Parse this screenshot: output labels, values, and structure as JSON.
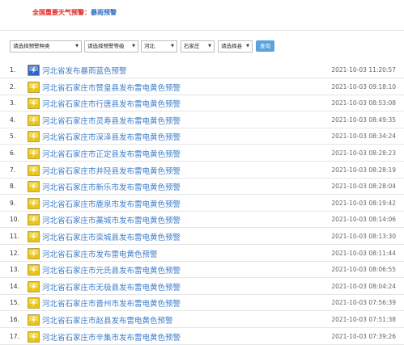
{
  "banner": {
    "prefix": "全国重要天气预警：",
    "active": "暴雨预警"
  },
  "filters": {
    "type": "请选择预警种类",
    "level": "请选择预警等级",
    "province": "河北",
    "city": "石家庄",
    "county": "请选择县",
    "query_label": "查询"
  },
  "list": [
    {
      "num": "1.",
      "title": "河北省发布暴雨蓝色预警",
      "time": "2021-10-03 11:20:57",
      "icon": "rainstorm-blue-warning-icon",
      "color": "#2f63c4"
    },
    {
      "num": "2.",
      "title": "河北省石家庄市赞皇县发布雷电黄色预警",
      "time": "2021-10-03 09:18:10",
      "icon": "lightning-yellow-warning-icon",
      "color": "#e8c516"
    },
    {
      "num": "3.",
      "title": "河北省石家庄市行唐县发布雷电黄色预警",
      "time": "2021-10-03 08:53:08",
      "icon": "lightning-yellow-warning-icon",
      "color": "#e8c516"
    },
    {
      "num": "4.",
      "title": "河北省石家庄市灵寿县发布雷电黄色预警",
      "time": "2021-10-03 08:49:35",
      "icon": "lightning-yellow-warning-icon",
      "color": "#e8c516"
    },
    {
      "num": "5.",
      "title": "河北省石家庄市深泽县发布雷电黄色预警",
      "time": "2021-10-03 08:34:24",
      "icon": "lightning-yellow-warning-icon",
      "color": "#e8c516"
    },
    {
      "num": "6.",
      "title": "河北省石家庄市正定县发布雷电黄色预警",
      "time": "2021-10-03 08:28:23",
      "icon": "lightning-yellow-warning-icon",
      "color": "#e8c516"
    },
    {
      "num": "7.",
      "title": "河北省石家庄市井陉县发布雷电黄色预警",
      "time": "2021-10-03 08:28:19",
      "icon": "lightning-yellow-warning-icon",
      "color": "#e8c516"
    },
    {
      "num": "8.",
      "title": "河北省石家庄市新乐市发布雷电黄色预警",
      "time": "2021-10-03 08:28:04",
      "icon": "lightning-yellow-warning-icon",
      "color": "#e8c516"
    },
    {
      "num": "9.",
      "title": "河北省石家庄市鹿泉市发布雷电黄色预警",
      "time": "2021-10-03 08:19:42",
      "icon": "lightning-yellow-warning-icon",
      "color": "#e8c516"
    },
    {
      "num": "10.",
      "title": "河北省石家庄市藁城市发布雷电黄色预警",
      "time": "2021-10-03 08:14:06",
      "icon": "lightning-yellow-warning-icon",
      "color": "#e8c516"
    },
    {
      "num": "11.",
      "title": "河北省石家庄市栾城县发布雷电黄色预警",
      "time": "2021-10-03 08:13:30",
      "icon": "lightning-yellow-warning-icon",
      "color": "#e8c516"
    },
    {
      "num": "12.",
      "title": "河北省石家庄市发布雷电黄色预警",
      "time": "2021-10-03 08:11:44",
      "icon": "lightning-yellow-warning-icon",
      "color": "#e8c516"
    },
    {
      "num": "13.",
      "title": "河北省石家庄市元氏县发布雷电黄色预警",
      "time": "2021-10-03 08:06:55",
      "icon": "lightning-yellow-warning-icon",
      "color": "#e8c516"
    },
    {
      "num": "14.",
      "title": "河北省石家庄市无极县发布雷电黄色预警",
      "time": "2021-10-03 08:04:24",
      "icon": "lightning-yellow-warning-icon",
      "color": "#e8c516"
    },
    {
      "num": "15.",
      "title": "河北省石家庄市晋州市发布雷电黄色预警",
      "time": "2021-10-03 07:56:39",
      "icon": "lightning-yellow-warning-icon",
      "color": "#e8c516"
    },
    {
      "num": "16.",
      "title": "河北省石家庄市赵县发布雷电黄色预警",
      "time": "2021-10-03 07:51:38",
      "icon": "lightning-yellow-warning-icon",
      "color": "#e8c516"
    },
    {
      "num": "17.",
      "title": "河北省石家庄市辛集市发布雷电黄色预警",
      "time": "2021-10-03 07:39:26",
      "icon": "lightning-yellow-warning-icon",
      "color": "#e8c516"
    }
  ]
}
